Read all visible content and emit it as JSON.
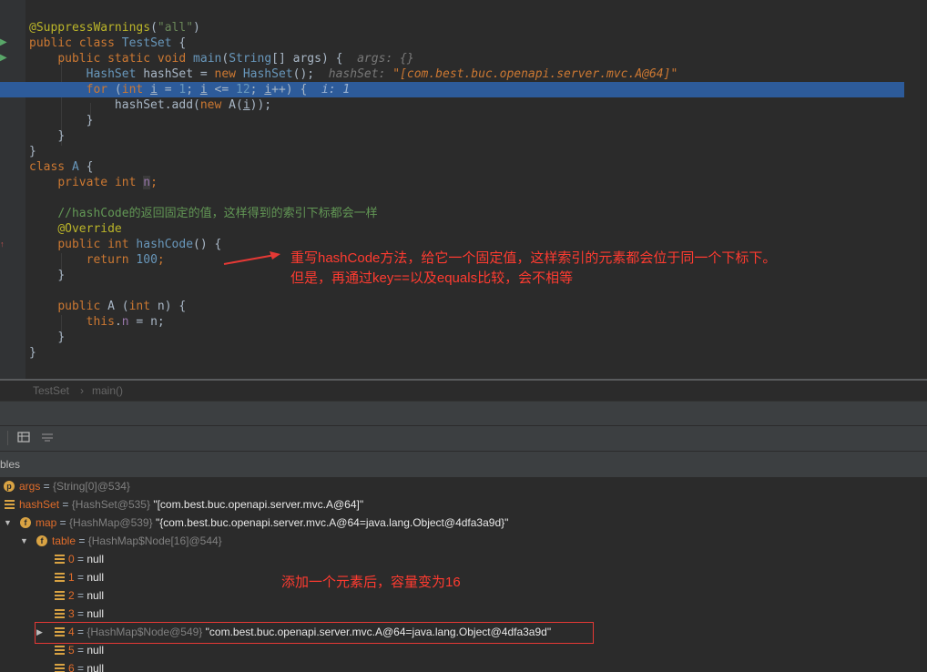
{
  "editor": {
    "lines": {
      "l1": {
        "anno": "@SuppressWarnings",
        "paren_open": "(",
        "arg": "\"all\"",
        "paren_close": ")"
      },
      "l2": {
        "kw1": "public",
        "kw2": "class",
        "name": "TestSet",
        "rest": " {"
      },
      "l3": {
        "kw1": "public",
        "kw2": "static",
        "kw3": "void",
        "name": "main",
        "p1": "(",
        "type": "String",
        "rest": "[] args) {",
        "hint": "args: {}"
      },
      "l4": {
        "type": "HashSet",
        "var": " hashSet = ",
        "kw": "new",
        "type2": "HashSet",
        "rest": "();",
        "hint_label": "hashSet: ",
        "hint_value": "\"[com.best.buc.openapi.server.mvc.A@64]\""
      },
      "l5": {
        "kw": "for",
        "p": " (",
        "kw2": "int",
        "sp": " ",
        "i1": "i",
        "eq": " = ",
        "one": "1",
        "sc": "; ",
        "i2": "i",
        "le": " <= ",
        "twelve": "12",
        "sc2": "; ",
        "i3": "i",
        "inc": "++) {",
        "hint": "i: 1"
      },
      "l6": {
        "a": "hashSet.",
        "m": "add",
        "b": "(",
        "kw": "new",
        "c": " ",
        "cls": "A",
        "d": "(",
        "i": "i",
        "e": "));"
      },
      "l7": "}",
      "l8": "}",
      "l9": "}",
      "l10": {
        "kw": "class",
        "cls": "A",
        "rest": " {"
      },
      "l11": {
        "kw1": "private",
        "kw2": "int",
        "sp": " ",
        "fld": "n",
        "rest": ";"
      },
      "l12": "//hashCode的返回固定的值，这样得到的索引下标都会一样",
      "l13": "@Override",
      "l14": {
        "kw1": "public",
        "kw2": "int",
        "name": "hashCode",
        "rest": "() {"
      },
      "l15": {
        "kw": "return",
        "sp": " ",
        "num": "100",
        "rest": ";"
      },
      "l16": "}",
      "l17": {
        "kw": "public",
        "name": " A ",
        "p": "(",
        "kw2": "int",
        "rest": " n) {"
      },
      "l18": {
        "kw": "this",
        "dot": ".",
        "fld": "n",
        "rest": " = n;"
      },
      "l19": "}",
      "l20": "}"
    },
    "annotation_line1": "重写hashCode方法，给它一个固定值，这样索引的元素都会位于同一个下标下。",
    "annotation_line2": "但是，再通过key==以及equals比较，会不相等",
    "annotation_color": "#ff3b30"
  },
  "breadcrumb": {
    "file": "TestSet",
    "sep": "›",
    "method": "main()"
  },
  "toolbar": {
    "icons": [
      "table-view-icon",
      "watches-icon"
    ]
  },
  "variables_panel": {
    "title": "bles",
    "rows": [
      {
        "name": "args",
        "eq": " = ",
        "type": "{String[0]@534}",
        "value": ""
      },
      {
        "name": "hashSet",
        "eq": " = ",
        "type": "{HashSet@535}",
        "value": " \"[com.best.buc.openapi.server.mvc.A@64]\""
      },
      {
        "name": "map",
        "eq": " = ",
        "type": "{HashMap@539}",
        "value": " \"{com.best.buc.openapi.server.mvc.A@64=java.lang.Object@4dfa3a9d}\""
      },
      {
        "name": "table",
        "eq": " = ",
        "type": "{HashMap$Node[16]@544}",
        "value": ""
      },
      {
        "name": "0",
        "eq": " = ",
        "type": "",
        "value": "null"
      },
      {
        "name": "1",
        "eq": " = ",
        "type": "",
        "value": "null"
      },
      {
        "name": "2",
        "eq": " = ",
        "type": "",
        "value": "null"
      },
      {
        "name": "3",
        "eq": " = ",
        "type": "",
        "value": "null"
      },
      {
        "name": "4",
        "eq": " = ",
        "type": "{HashMap$Node@549}",
        "value": " \"com.best.buc.openapi.server.mvc.A@64=java.lang.Object@4dfa3a9d\""
      },
      {
        "name": "5",
        "eq": " = ",
        "type": "",
        "value": "null"
      },
      {
        "name": "6",
        "eq": " = ",
        "type": "",
        "value": "null"
      }
    ],
    "annotation": "添加一个元素后，容量变为16"
  }
}
